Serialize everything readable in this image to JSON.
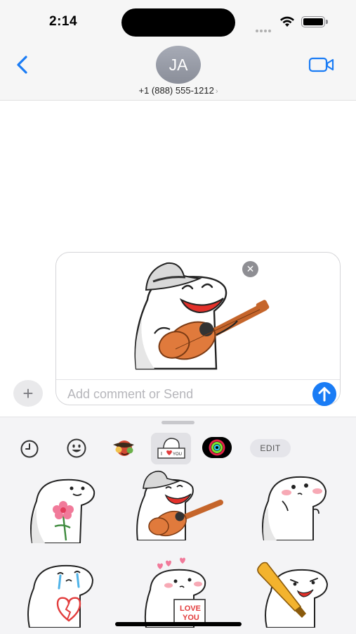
{
  "status_bar": {
    "time": "2:14"
  },
  "header": {
    "avatar_initials": "JA",
    "contact_phone": "+1 (888) 555-1212",
    "contact_chevron": "›"
  },
  "composer": {
    "placeholder": "Add comment or Send",
    "value": "",
    "remove_glyph": "✕",
    "plus_glyph": "+"
  },
  "sticker_drawer": {
    "tabs": [
      {
        "name": "recent",
        "icon": "clock-icon"
      },
      {
        "name": "emoji",
        "icon": "smiley-icon"
      },
      {
        "name": "sticker-pack-1",
        "icon": "pack-icon"
      },
      {
        "name": "sticker-pack-2",
        "icon": "i-love-you-pack-icon",
        "selected": true
      },
      {
        "name": "activity",
        "icon": "activity-rings-icon"
      }
    ],
    "edit_label": "EDIT",
    "stickers": [
      {
        "name": "flower"
      },
      {
        "name": "ukulele"
      },
      {
        "name": "shy-blush"
      },
      {
        "name": "crying-broken-heart"
      },
      {
        "name": "love-you-sign",
        "text": "LOVE YOU"
      },
      {
        "name": "baseball-bat"
      }
    ]
  },
  "colors": {
    "accent": "#1a7cf5",
    "nav_background": "#f6f6f6",
    "drawer_background": "#f4f4f6",
    "guitar": "#e07a3c",
    "hat": "#d6d6d6",
    "mouth": "#e3312b",
    "blush": "#f7a9b5"
  }
}
